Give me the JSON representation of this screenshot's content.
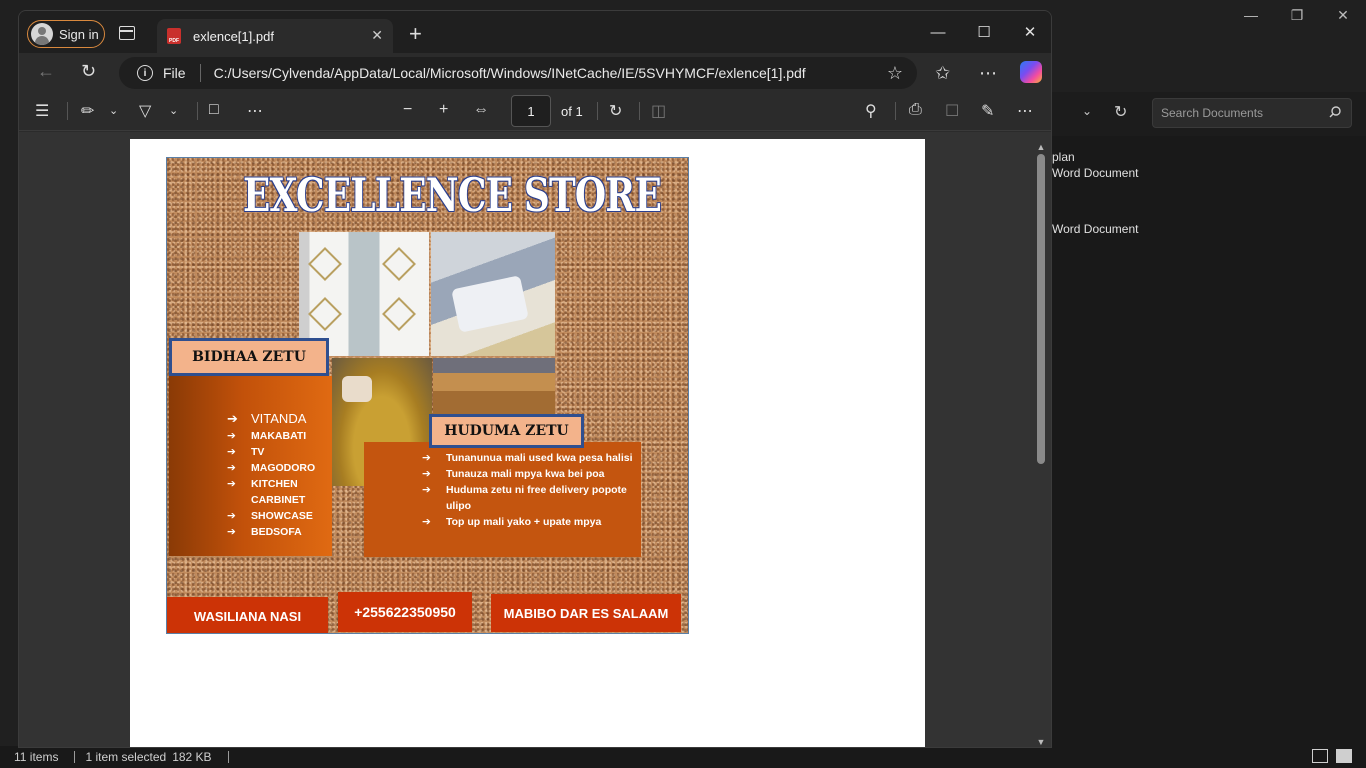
{
  "explorer": {
    "search_placeholder": "Search Documents",
    "files": [
      {
        "name": "plan",
        "type": "Word Document"
      },
      {
        "type": "Word Document"
      }
    ],
    "status": {
      "items": "11 items",
      "selected": "1 item selected",
      "size": "182 KB"
    }
  },
  "edge": {
    "signin_label": "Sign in",
    "tab_title": "exlence[1].pdf",
    "url_scheme": "File",
    "url": "C:/Users/Cylvenda/AppData/Local/Microsoft/Windows/INetCache/IE/5SVHYMCF/exlence[1].pdf"
  },
  "pdf_toolbar": {
    "page_current": "1",
    "page_total": "of 1"
  },
  "flyer": {
    "title": "EXCELLENCE STORE",
    "products_label": "BIDHAA ZETU",
    "products": [
      "VITANDA",
      "MAKABATI",
      "TV",
      "MAGODORO",
      "KITCHEN CARBINET",
      "SHOWCASE",
      "BEDSOFA"
    ],
    "services_label": "HUDUMA ZETU",
    "services": [
      "Tunanunua mali used kwa pesa halisi",
      "Tunauza mali mpya kwa bei poa",
      "Huduma zetu ni free delivery popote ulipo",
      "Top up mali yako  + upate mpya"
    ],
    "contact_label": "WASILIANA NASI",
    "phone": "+255622350950",
    "location": "MABIBO DAR ES SALAAM"
  },
  "colors": {
    "accent": "#d9893e",
    "flyer_orange": "#c4550f",
    "flyer_red": "#cc3306",
    "label_bg": "#f3b38b",
    "label_border": "#2f4f8f"
  }
}
